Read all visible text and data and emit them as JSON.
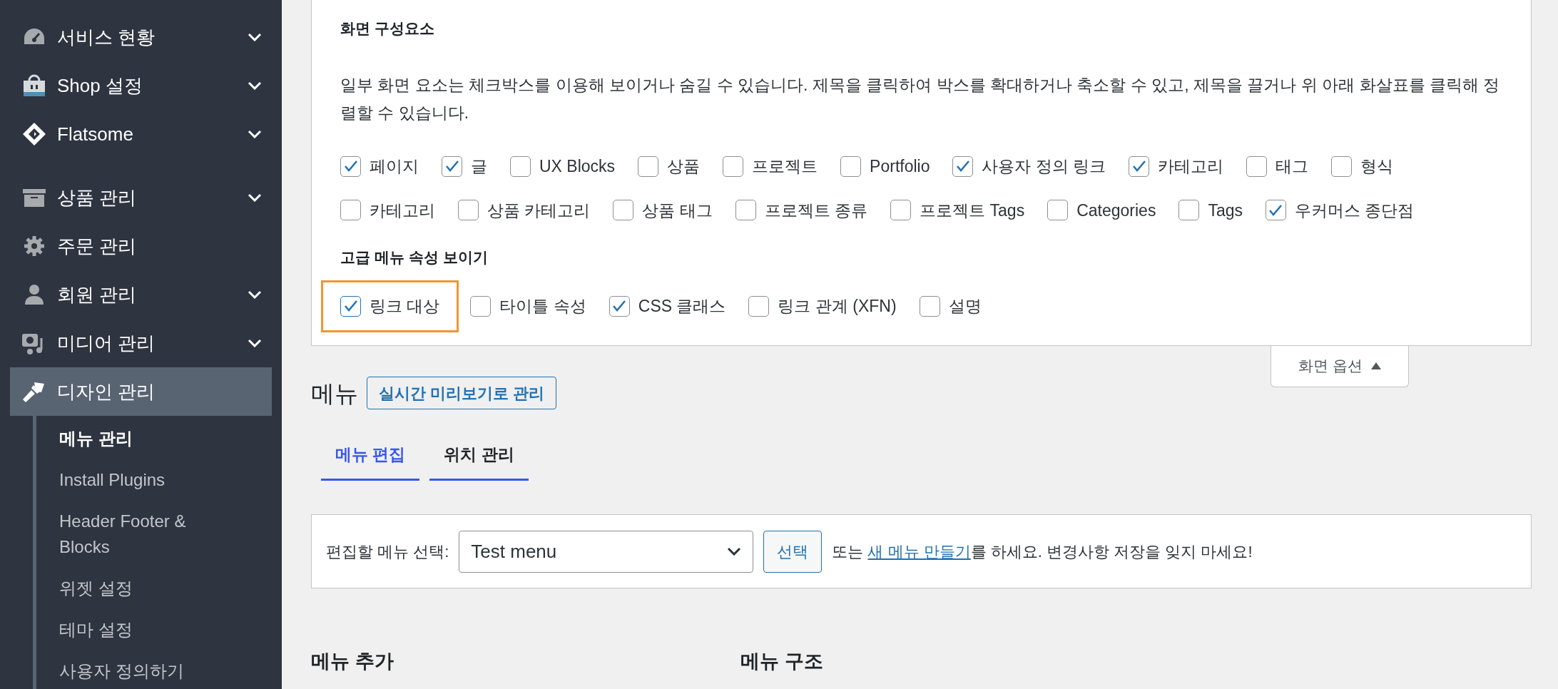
{
  "sidebar": {
    "groups": [
      [
        {
          "label": "서비스 현황",
          "submenu": true,
          "selected": false
        },
        {
          "label": "Shop 설정",
          "submenu": true,
          "selected": false
        },
        {
          "label": "Flatsome",
          "submenu": true,
          "selected": false
        }
      ],
      [
        {
          "label": "상품 관리",
          "submenu": true,
          "selected": false
        },
        {
          "label": "주문 관리",
          "submenu": false,
          "selected": false
        },
        {
          "label": "회원 관리",
          "submenu": true,
          "selected": false
        },
        {
          "label": "미디어 관리",
          "submenu": true,
          "selected": false
        },
        {
          "label": "디자인 관리",
          "submenu": false,
          "selected": true
        }
      ]
    ],
    "subitems": [
      {
        "label": "메뉴 관리",
        "selected": true
      },
      {
        "label": "Install Plugins",
        "selected": false
      },
      {
        "label": "Header Footer & Blocks",
        "selected": false
      },
      {
        "label": "위젯 설정",
        "selected": false
      },
      {
        "label": "테마 설정",
        "selected": false
      },
      {
        "label": "사용자 정의하기",
        "selected": false
      }
    ]
  },
  "screen_options": {
    "title": "화면 구성요소",
    "description": "일부 화면 요소는 체크박스를 이용해 보이거나 숨길 수 있습니다. 제목을 클릭하여 박스를 확대하거나 축소할 수 있고, 제목을 끌거나 위 아래 화살표를 클릭해 정렬할 수 있습니다.",
    "options": [
      {
        "label": "페이지",
        "checked": true
      },
      {
        "label": "글",
        "checked": true
      },
      {
        "label": "UX Blocks",
        "checked": false
      },
      {
        "label": "상품",
        "checked": false
      },
      {
        "label": "프로젝트",
        "checked": false
      },
      {
        "label": "Portfolio",
        "checked": false
      },
      {
        "label": "사용자 정의 링크",
        "checked": true
      },
      {
        "label": "카테고리",
        "checked": true
      },
      {
        "label": "태그",
        "checked": false
      },
      {
        "label": "형식",
        "checked": false
      },
      {
        "label": "카테고리",
        "checked": false
      },
      {
        "label": "상품 카테고리",
        "checked": false
      },
      {
        "label": "상품 태그",
        "checked": false
      },
      {
        "label": "프로젝트 종류",
        "checked": false
      },
      {
        "label": "프로젝트 Tags",
        "checked": false
      },
      {
        "label": "Categories",
        "checked": false
      },
      {
        "label": "Tags",
        "checked": false
      },
      {
        "label": "우커머스 종단점",
        "checked": true
      }
    ],
    "advanced_title": "고급 메뉴 속성 보이기",
    "advanced": [
      {
        "label": "링크 대상",
        "checked": true,
        "highlighted": true
      },
      {
        "label": "타이틀 속성",
        "checked": false,
        "highlighted": false
      },
      {
        "label": "CSS 클래스",
        "checked": true,
        "highlighted": false
      },
      {
        "label": "링크 관계 (XFN)",
        "checked": false,
        "highlighted": false
      },
      {
        "label": "설명",
        "checked": false,
        "highlighted": false
      }
    ],
    "toggle": {
      "label": "화면 옵션",
      "expanded": true
    }
  },
  "page": {
    "title": "메뉴",
    "action": "실시간 미리보기로 관리",
    "tabs": [
      {
        "label": "메뉴 편집",
        "selected": true
      },
      {
        "label": "위치 관리",
        "selected": false
      }
    ],
    "menu_select": {
      "label": "편집할 메뉴 선택:",
      "value": "Test menu",
      "button": "선택",
      "note_before": "또는 ",
      "link": "새 메뉴 만들기",
      "note_after": "를 하세요. 변경사항 저장을 잊지 마세요!"
    },
    "sections": [
      "메뉴 추가",
      "메뉴 구조"
    ]
  }
}
